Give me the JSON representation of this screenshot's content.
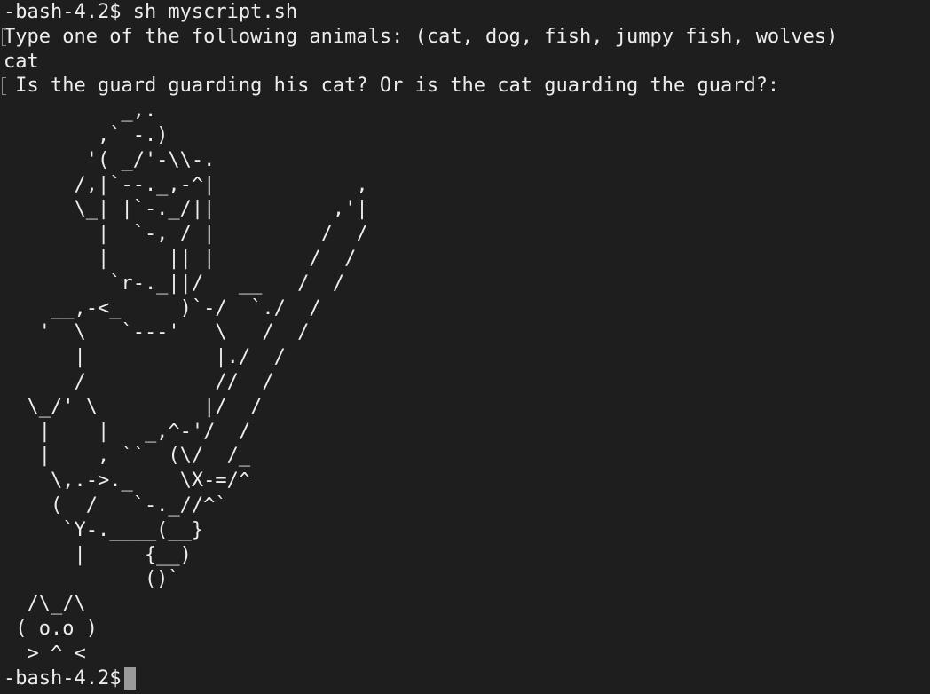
{
  "terminal": {
    "command_line": "-bash-4.2$ sh myscript.sh",
    "menu_prompt": "Type one of the following animals: (cat, dog, fish, jumpy fish, wolves)",
    "user_input": "cat",
    "question": " Is the guard guarding his cat? Or is the cat guarding the guard?:",
    "guard_art": "          _,.\n        ,` -.)\n       '( _/'-\\\\-.\n      /,|`--._,-^|            ,\n      \\_| |`-._/||          ,'|\n        |  `-, / |         /  /\n        |     || |        /  /\n         `r-._||/   __   /  /\n    __,-<_     )`-/  `./  /\n   '  \\   `---'   \\   /  /\n      |           |./  /\n      /           //  /\n  \\_/' \\         |/  /\n   |    |   _,^-'/  /\n   |    , ``  (\\/  /_\n    \\,.->._    \\X-=/^\n    (  /   `-._//^`\n     `Y-.____(__}\n      |     {__)\n            ()`",
    "cat_art": "  /\\_/\\\n ( o.o )\n  > ^ <",
    "final_prompt": "-bash-4.2$",
    "colors": {
      "background": "#1e1e1e",
      "foreground": "#ededed",
      "cursor": "#9a9a9a"
    }
  }
}
